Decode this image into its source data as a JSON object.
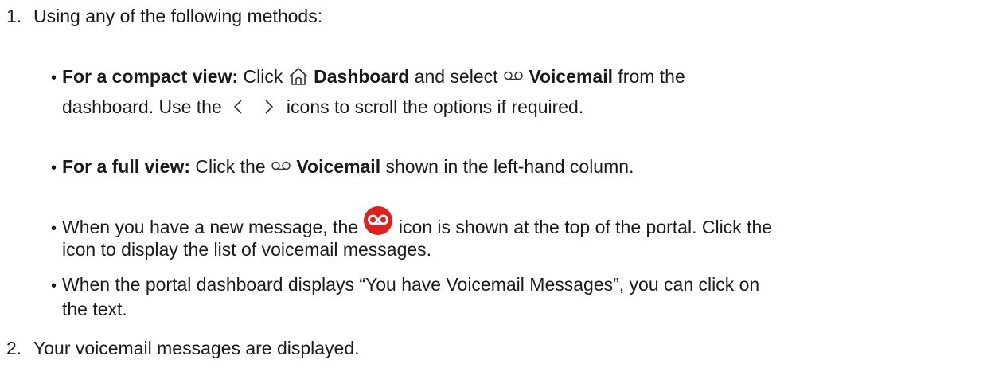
{
  "steps": [
    {
      "number": "1.",
      "text": "Using any of the following methods:"
    },
    {
      "number": "2.",
      "text": "Your voicemail messages are displayed."
    }
  ],
  "bullets": {
    "symbol": "•",
    "compact": {
      "bold_lead": "For a compact view:",
      "t1": "Click",
      "dashboard": "Dashboard",
      "t2": "and select",
      "voicemail": "Voicemail",
      "t3": "from the",
      "line2_a": "dashboard. Use the",
      "line2_b": "icons to scroll the options if required."
    },
    "full": {
      "bold_lead": "For a full view:",
      "t1": "Click the",
      "voicemail": "Voicemail",
      "t2": "shown in the left-hand column."
    },
    "new_message": {
      "t1": "When you have a new message, the",
      "t2": "icon is shown at the top of the portal. Click the",
      "line2": "icon to display the list of voicemail messages."
    },
    "dashboard_text": {
      "line1": "When the portal dashboard displays “You have Voicemail Messages”, you can click on",
      "line2": "the text."
    }
  },
  "icons": {
    "home": "home-icon",
    "voicemail": "voicemail-icon",
    "chevron_left": "chevron-left-icon",
    "chevron_right": "chevron-right-icon",
    "voicemail_badge": "voicemail-badge-icon"
  },
  "colors": {
    "text": "#1a1a1a",
    "badge": "#e0201b"
  }
}
